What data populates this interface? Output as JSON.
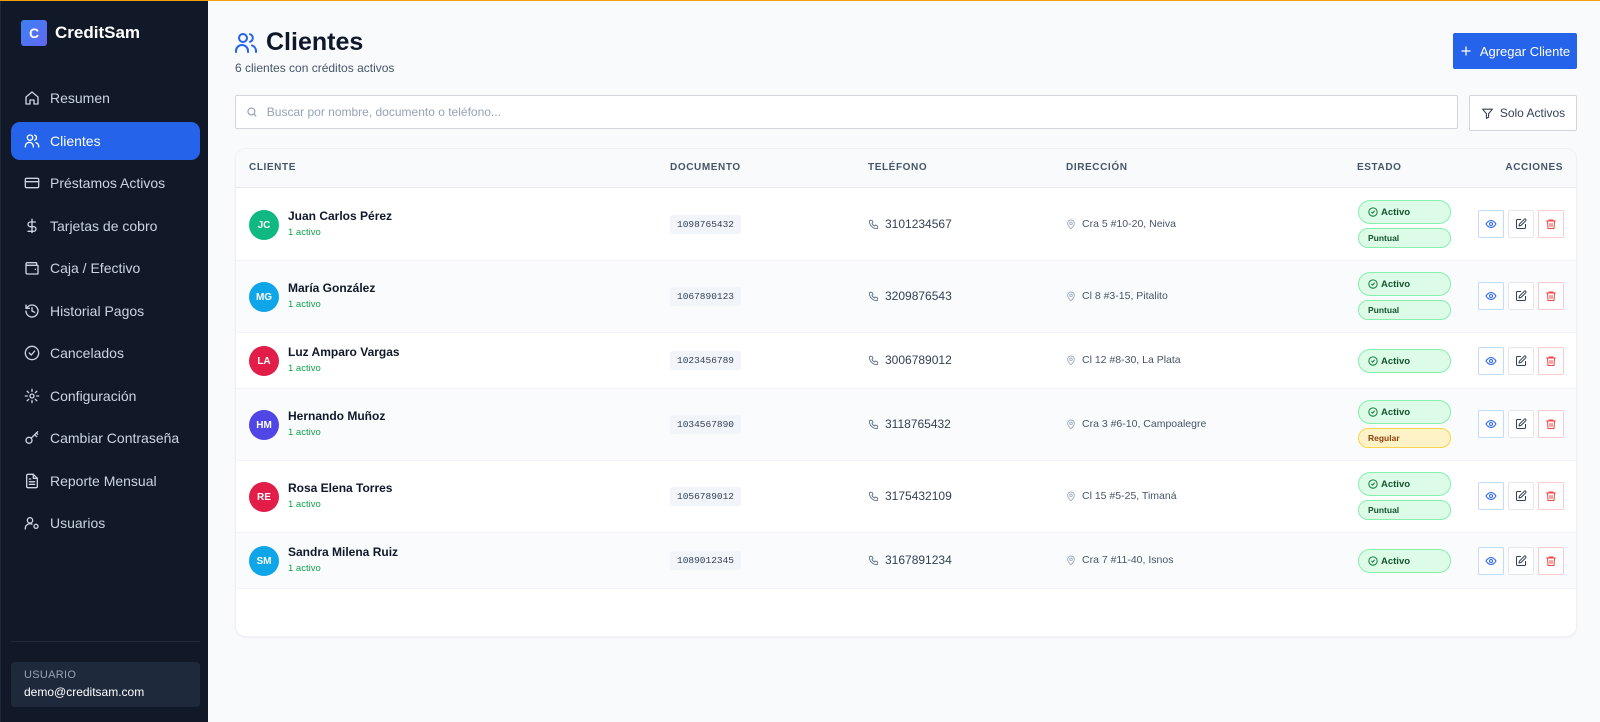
{
  "brand": {
    "logo_letter": "C",
    "name": "CreditSam"
  },
  "sidebar": {
    "items": [
      {
        "label": "Resumen",
        "icon": "home-icon",
        "active": false
      },
      {
        "label": "Clientes",
        "icon": "users-icon",
        "active": true
      },
      {
        "label": "Préstamos Activos",
        "icon": "credit-card-icon",
        "active": false
      },
      {
        "label": "Tarjetas de cobro",
        "icon": "dollar-icon",
        "active": false
      },
      {
        "label": "Caja / Efectivo",
        "icon": "wallet-icon",
        "active": false
      },
      {
        "label": "Historial Pagos",
        "icon": "history-icon",
        "active": false
      },
      {
        "label": "Cancelados",
        "icon": "check-circle-icon",
        "active": false
      },
      {
        "label": "Configuración",
        "icon": "gear-icon",
        "active": false
      },
      {
        "label": "Cambiar Contraseña",
        "icon": "key-icon",
        "active": false
      },
      {
        "label": "Reporte Mensual",
        "icon": "file-icon",
        "active": false
      },
      {
        "label": "Usuarios",
        "icon": "user-cog-icon",
        "active": false
      }
    ],
    "user_label": "USUARIO",
    "user_email": "demo@creditsam.com"
  },
  "header": {
    "title": "Clientes",
    "subtitle": "6 clientes con créditos activos",
    "add_button": "Agregar Cliente"
  },
  "search": {
    "placeholder": "Buscar por nombre, documento o teléfono...",
    "value": "",
    "filter_label": "Solo Activos"
  },
  "table": {
    "headers": {
      "cliente": "CLIENTE",
      "documento": "DOCUMENTO",
      "telefono": "TELÉFONO",
      "direccion": "DIRECCIÓN",
      "estado": "ESTADO",
      "acciones": "ACCIONES"
    },
    "rows": [
      {
        "initials": "JC",
        "avatar_color": "#10b981",
        "name": "Juan Carlos Pérez",
        "sub": "1 activo",
        "document": "1098765432",
        "phone": "3101234567",
        "address": "Cra 5 #10-20, Neiva",
        "status": "Activo",
        "rating": "Puntual",
        "rating_type": "puntual"
      },
      {
        "initials": "MG",
        "avatar_color": "#0ea5e9",
        "name": "María González",
        "sub": "1 activo",
        "document": "1067890123",
        "phone": "3209876543",
        "address": "Cl 8 #3-15, Pitalito",
        "status": "Activo",
        "rating": "Puntual",
        "rating_type": "puntual"
      },
      {
        "initials": "LA",
        "avatar_color": "#e11d48",
        "name": "Luz Amparo Vargas",
        "sub": "1 activo",
        "document": "1023456789",
        "phone": "3006789012",
        "address": "Cl 12 #8-30, La Plata",
        "status": "Activo",
        "rating": "",
        "rating_type": ""
      },
      {
        "initials": "HM",
        "avatar_color": "#4f46e5",
        "name": "Hernando Muñoz",
        "sub": "1 activo",
        "document": "1034567890",
        "phone": "3118765432",
        "address": "Cra 3 #6-10, Campoalegre",
        "status": "Activo",
        "rating": "Regular",
        "rating_type": "regular"
      },
      {
        "initials": "RE",
        "avatar_color": "#e11d48",
        "name": "Rosa Elena Torres",
        "sub": "1 activo",
        "document": "1056789012",
        "phone": "3175432109",
        "address": "Cl 15 #5-25, Timaná",
        "status": "Activo",
        "rating": "Puntual",
        "rating_type": "puntual"
      },
      {
        "initials": "SM",
        "avatar_color": "#0ea5e9",
        "name": "Sandra Milena Ruiz",
        "sub": "1 activo",
        "document": "1089012345",
        "phone": "3167891234",
        "address": "Cra 7 #11-40, Isnos",
        "status": "Activo",
        "rating": "",
        "rating_type": ""
      }
    ]
  },
  "colors": {
    "accent": "#2563eb",
    "sidebar_bg": "#111827",
    "success": "#16a34a",
    "danger": "#ef4444",
    "warning": "#92400e"
  }
}
